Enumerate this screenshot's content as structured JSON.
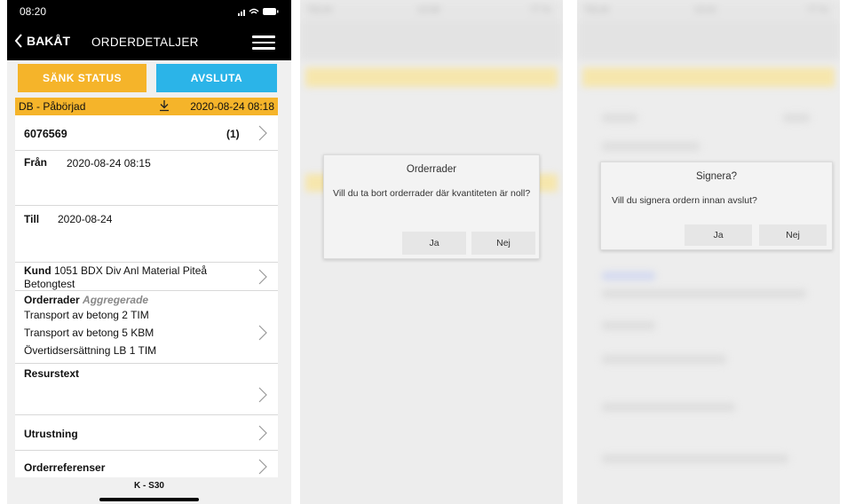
{
  "screen1": {
    "status_time": "08:20",
    "nav": {
      "back_label": "BAKÅT",
      "title": "ORDERDETALJER"
    },
    "buttons": {
      "sank_status": "SÄNK STATUS",
      "avsluta": "AVSLUTA"
    },
    "status_bar": {
      "status": "DB - Påbörjad",
      "datetime": "2020-08-24 08:18"
    },
    "order": {
      "number": "6076569",
      "count": "(1)"
    },
    "fran": {
      "label": "Från",
      "value": "2020-08-24 08:15"
    },
    "till": {
      "label": "Till",
      "value": "2020-08-24"
    },
    "kund": {
      "label": "Kund",
      "value": "1051 BDX Div Anl Material Piteå Betongtest"
    },
    "orderrader": {
      "label": "Orderrader",
      "sublabel": "Aggregerade",
      "items": [
        "Transport av betong 2 TIM",
        "Transport av betong 5 KBM",
        "Övertidsersättning LB 1 TIM"
      ]
    },
    "resurstext": {
      "label": "Resurstext"
    },
    "utrustning": {
      "label": "Utrustning"
    },
    "orderreferenser": {
      "label": "Orderreferenser"
    },
    "footer": "K - S30",
    "colors": {
      "yellow": "#f5b42a",
      "blue": "#2bb4e8",
      "black": "#000000"
    }
  },
  "screen2": {
    "carrier": "TELIA",
    "time": "13:39",
    "battery": "77 %",
    "dialog": {
      "title": "Orderrader",
      "message": "Vill du ta bort orderrader där kvantiteten är noll?",
      "yes": "Ja",
      "no": "Nej"
    }
  },
  "screen3": {
    "carrier": "TELIA",
    "time": "13:41",
    "battery": "77 %",
    "dialog": {
      "title": "Signera?",
      "message": "Vill du signera ordern innan avslut?",
      "yes": "Ja",
      "no": "Nej"
    }
  }
}
